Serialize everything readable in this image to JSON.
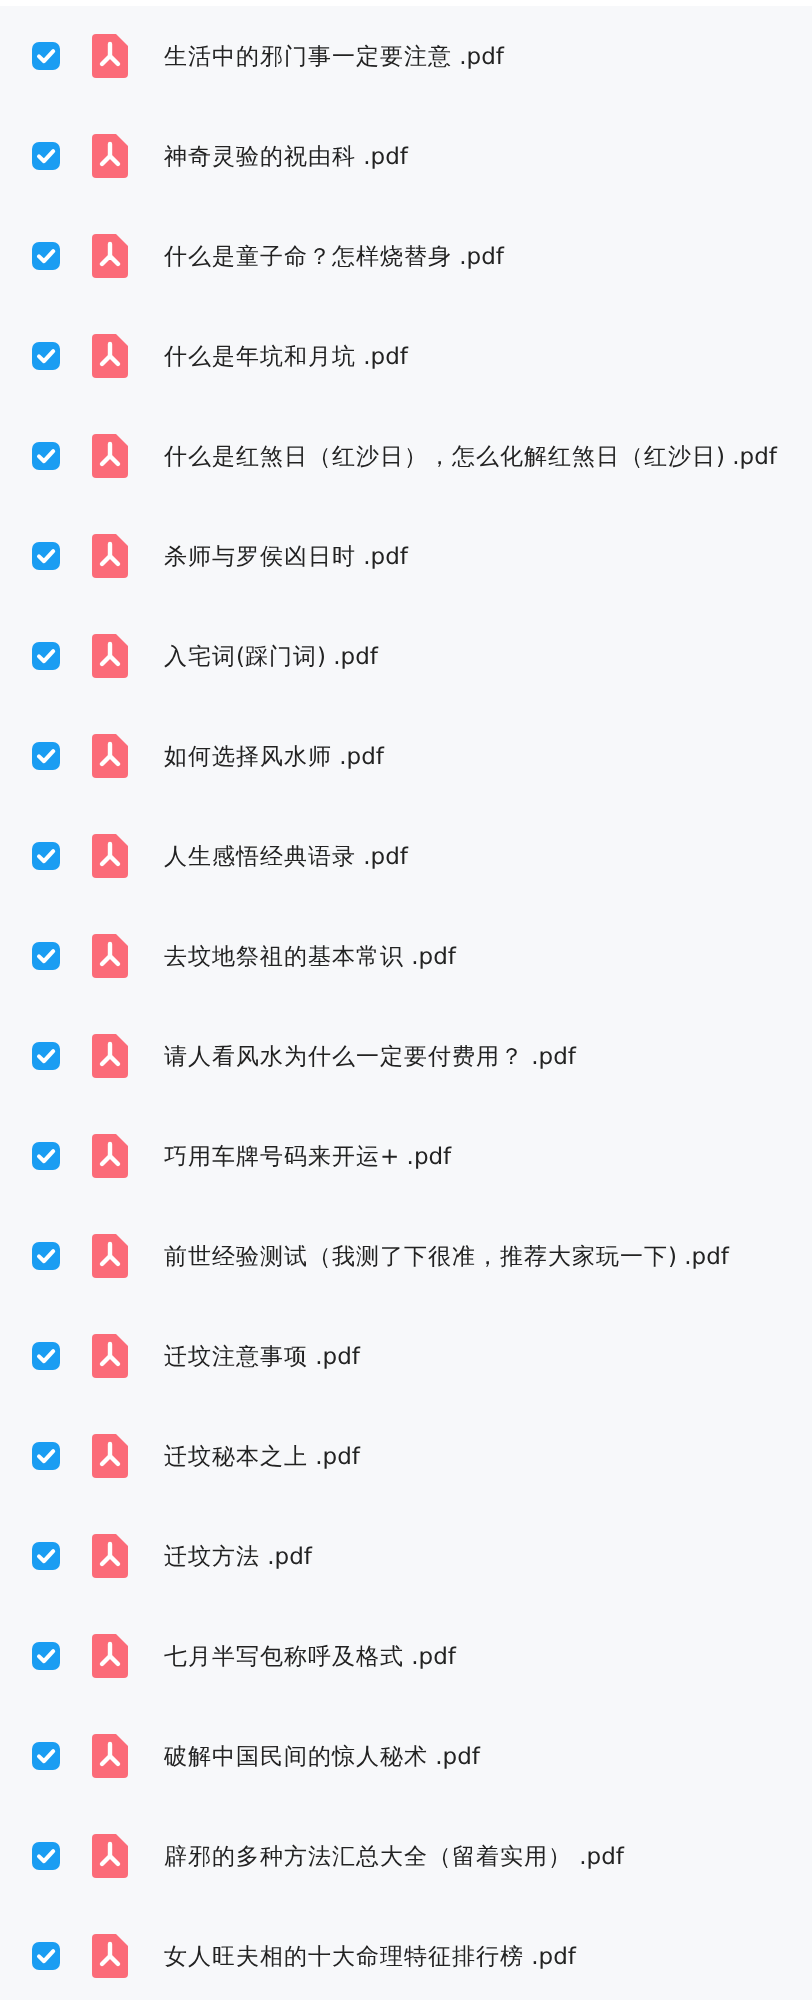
{
  "files": [
    {
      "name": "生活中的邪门事一定要注意 .pdf",
      "checked": true
    },
    {
      "name": "神奇灵验的祝由科 .pdf",
      "checked": true
    },
    {
      "name": "什么是童子命？怎样烧替身 .pdf",
      "checked": true
    },
    {
      "name": "什么是年坑和月坑 .pdf",
      "checked": true
    },
    {
      "name": "什么是红煞日（红沙日），怎么化解红煞日（红沙日) .pdf",
      "checked": true
    },
    {
      "name": "杀师与罗侯凶日时 .pdf",
      "checked": true
    },
    {
      "name": "入宅词(踩门词) .pdf",
      "checked": true
    },
    {
      "name": "如何选择风水师 .pdf",
      "checked": true
    },
    {
      "name": "人生感悟经典语录 .pdf",
      "checked": true
    },
    {
      "name": "去坟地祭祖的基本常识 .pdf",
      "checked": true
    },
    {
      "name": "请人看风水为什么一定要付费用？ .pdf",
      "checked": true
    },
    {
      "name": "巧用车牌号码来开运+ .pdf",
      "checked": true
    },
    {
      "name": "前世经验测试（我测了下很准，推荐大家玩一下) .pdf",
      "checked": true
    },
    {
      "name": "迁坟注意事项 .pdf",
      "checked": true
    },
    {
      "name": "迁坟秘本之上 .pdf",
      "checked": true
    },
    {
      "name": "迁坟方法 .pdf",
      "checked": true
    },
    {
      "name": "七月半写包称呼及格式 .pdf",
      "checked": true
    },
    {
      "name": "破解中国民间的惊人秘术 .pdf",
      "checked": true
    },
    {
      "name": "辟邪的多种方法汇总大全（留着实用） .pdf",
      "checked": true
    },
    {
      "name": "女人旺夫相的十大命理特征排行榜 .pdf",
      "checked": true
    }
  ]
}
